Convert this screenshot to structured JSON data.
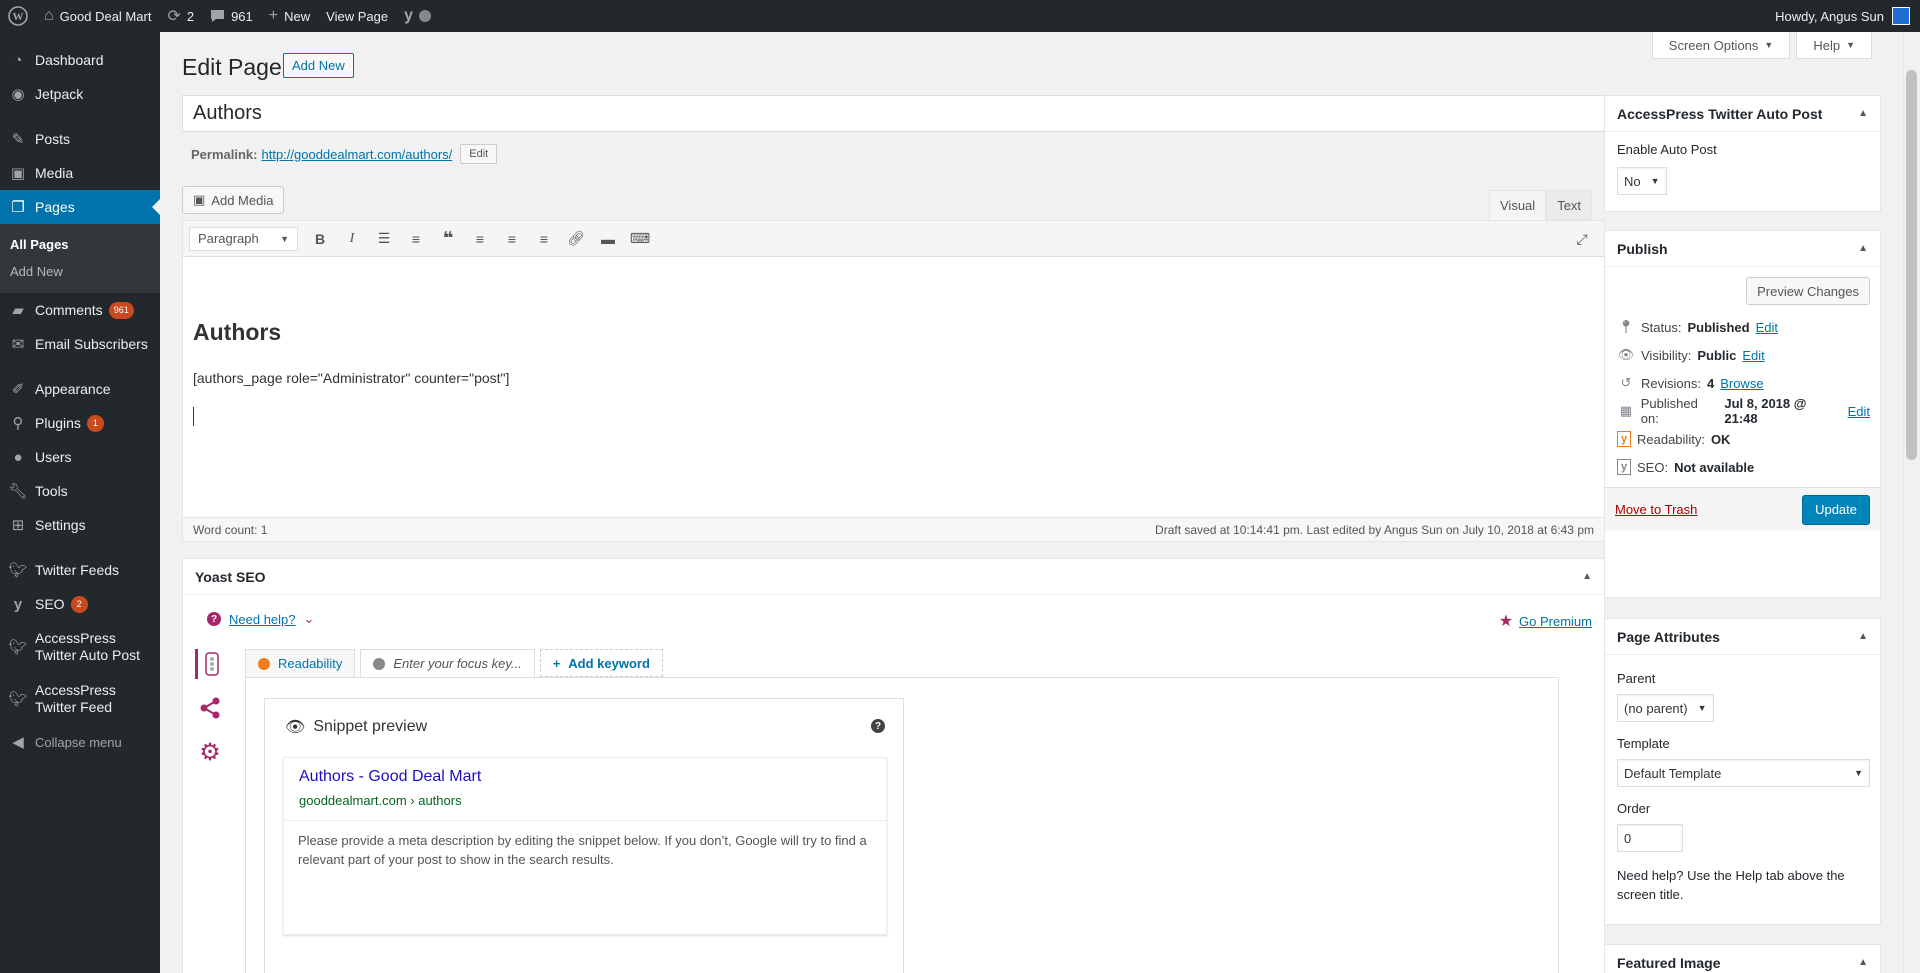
{
  "adminbar": {
    "site_name": "Good Deal Mart",
    "updates_count": "2",
    "comments_count": "961",
    "new_label": "New",
    "view_page_label": "View Page",
    "howdy": "Howdy, Angus Sun"
  },
  "sidebar": {
    "items": [
      {
        "label": "Dashboard",
        "icon": "dashboard-icon"
      },
      {
        "label": "Jetpack",
        "icon": "jetpack-icon"
      },
      {
        "label": "Posts",
        "icon": "pin-icon"
      },
      {
        "label": "Media",
        "icon": "media-icon"
      },
      {
        "label": "Pages",
        "icon": "pages-icon"
      },
      {
        "label": "Comments",
        "icon": "comment-icon",
        "badge": "961"
      },
      {
        "label": "Email Subscribers",
        "icon": "email-icon"
      },
      {
        "label": "Appearance",
        "icon": "brush-icon"
      },
      {
        "label": "Plugins",
        "icon": "plugin-icon",
        "badge": "1"
      },
      {
        "label": "Users",
        "icon": "user-icon"
      },
      {
        "label": "Tools",
        "icon": "wrench-icon"
      },
      {
        "label": "Settings",
        "icon": "settings-icon"
      },
      {
        "label": "Twitter Feeds",
        "icon": "twitter-icon"
      },
      {
        "label": "SEO",
        "icon": "yoast-icon",
        "badge": "2"
      },
      {
        "label": "AccessPress Twitter Auto Post",
        "icon": "twitter-icon"
      },
      {
        "label": "AccessPress Twitter Feed",
        "icon": "twitter-icon"
      },
      {
        "label": "Collapse menu",
        "icon": "collapse-icon"
      }
    ],
    "submenu": [
      "All Pages",
      "Add New"
    ]
  },
  "header": {
    "screen_options": "Screen Options",
    "help": "Help",
    "title": "Edit Page",
    "add_new": "Add New"
  },
  "post": {
    "title": "Authors",
    "permalink_label": "Permalink:",
    "permalink_url": "http://gooddealmart.com/authors/",
    "permalink_edit": "Edit"
  },
  "editor": {
    "add_media": "Add Media",
    "tab_visual": "Visual",
    "tab_text": "Text",
    "format": "Paragraph",
    "heading": "Authors",
    "shortcode": "[authors_page role=\"Administrator\" counter=\"post\"]",
    "word_count": "Word count: 1",
    "draft_status": "Draft saved at 10:14:41 pm. Last edited by Angus Sun on July 10, 2018 at 6:43 pm"
  },
  "yoast": {
    "title": "Yoast SEO",
    "need_help": "Need help?",
    "go_premium": "Go Premium",
    "tab_readability": "Readability",
    "focus_placeholder": "Enter your focus key...",
    "add_keyword": "Add keyword",
    "snippet_heading": "Snippet preview",
    "snippet_title": "Authors - Good Deal Mart",
    "snippet_url": "gooddealmart.com › authors",
    "snippet_desc": "Please provide a meta description by editing the snippet below. If you don’t, Google will try to find a relevant part of your post to show in the search results."
  },
  "twitter_box": {
    "title": "AccessPress Twitter Auto Post",
    "label": "Enable Auto Post",
    "value": "No"
  },
  "publish": {
    "title": "Publish",
    "preview": "Preview Changes",
    "status_label": "Status:",
    "status_value": "Published",
    "visibility_label": "Visibility:",
    "visibility_value": "Public",
    "revisions_label": "Revisions:",
    "revisions_value": "4",
    "browse": "Browse",
    "published_label": "Published on:",
    "published_value": "Jul 8, 2018 @ 21:48",
    "edit": "Edit",
    "readability_label": "Readability:",
    "readability_value": "OK",
    "seo_label": "SEO:",
    "seo_value": "Not available",
    "trash": "Move to Trash",
    "update": "Update"
  },
  "attributes": {
    "title": "Page Attributes",
    "parent_label": "Parent",
    "parent_value": "(no parent)",
    "template_label": "Template",
    "template_value": "Default Template",
    "order_label": "Order",
    "order_value": "0",
    "help": "Need help? Use the Help tab above the screen title."
  },
  "featured": {
    "title": "Featured Image"
  },
  "colors": {
    "admin_dark": "#23282d",
    "accent": "#0073aa",
    "badge": "#ca4a1f",
    "yoast": "#a4286a"
  }
}
